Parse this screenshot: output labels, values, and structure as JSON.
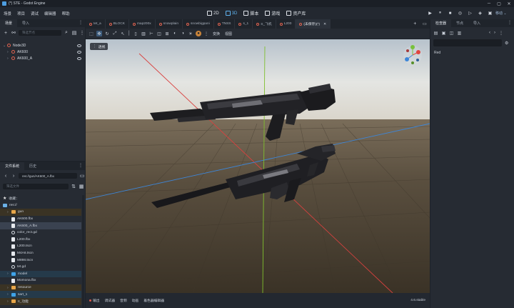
{
  "window": {
    "title": "(*) STE - Godot Engine",
    "minimize": "─",
    "maximize": "▢",
    "close": "✕"
  },
  "menu": [
    "场景",
    "项目",
    "调试",
    "编辑器",
    "帮助"
  ],
  "modes": [
    {
      "label": "2D",
      "active": false
    },
    {
      "label": "3D",
      "active": true
    },
    {
      "label": "脚本",
      "active": false
    },
    {
      "label": "游戏",
      "active": false
    },
    {
      "label": "资产库",
      "active": false
    }
  ],
  "renderer": "移动 ⌄",
  "scene_dock": {
    "tabs": [
      "场景",
      "导入"
    ],
    "filter_placeholder": "筛选节点",
    "tree": [
      {
        "label": "Node3D",
        "indent": 0
      },
      {
        "label": "AK600",
        "indent": 1
      },
      {
        "label": "AK600_A",
        "indent": 1
      }
    ]
  },
  "filesystem_dock": {
    "tabs": [
      "文件系统",
      "历史"
    ],
    "path": "res://gun/AK600_A.fbx",
    "filter_placeholder": "筛选文件",
    "items": [
      {
        "label": "收藏：",
        "icon": "star",
        "indent": 0
      },
      {
        "label": "res://",
        "icon": "folder",
        "indent": 0
      },
      {
        "label": "gun",
        "icon": "folder-orange",
        "indent": 1
      },
      {
        "label": "AK600.fbx",
        "icon": "file",
        "indent": 2
      },
      {
        "label": "AK600_A.fbx",
        "icon": "file",
        "indent": 2,
        "selected": true
      },
      {
        "label": "color_rect.gd",
        "icon": "gear",
        "indent": 2
      },
      {
        "label": "L200.fbx",
        "icon": "file",
        "indent": 2
      },
      {
        "label": "L200.tscn",
        "icon": "file",
        "indent": 2
      },
      {
        "label": "M4A6.tscn",
        "icon": "file",
        "indent": 2
      },
      {
        "label": "M898.tscn",
        "icon": "file",
        "indent": 2
      },
      {
        "label": "tet.gd",
        "icon": "gear",
        "indent": 2
      },
      {
        "label": "model",
        "icon": "folder-blue",
        "indent": 1
      },
      {
        "label": "Momona.fbx",
        "icon": "file",
        "indent": 2
      },
      {
        "label": "resource",
        "icon": "folder-orange",
        "indent": 1
      },
      {
        "label": "sart_1",
        "icon": "folder-blue",
        "indent": 1
      },
      {
        "label": "II_功能",
        "icon": "folder-orange",
        "indent": 1
      }
    ]
  },
  "editor_tabs": [
    {
      "label": "tet_a",
      "active": false
    },
    {
      "label": "BLOCK",
      "active": false
    },
    {
      "label": "map200x",
      "active": false
    },
    {
      "label": "snowplain",
      "active": false
    },
    {
      "label": "snowbigpani",
      "active": false
    },
    {
      "label": "TNSS",
      "active": false
    },
    {
      "label": "s_1",
      "active": false
    },
    {
      "label": "S_飞机",
      "active": false
    },
    {
      "label": "L200",
      "active": false
    },
    {
      "label": "(未保存)(*)",
      "active": true
    }
  ],
  "viewport_toolbar_labels": [
    "变换",
    "视图"
  ],
  "viewport_menu_label": "透视",
  "bottom_panel": [
    "输出",
    "调试器",
    "音频",
    "动画",
    "着色器编辑器"
  ],
  "version": "4.6.stable",
  "inspector": {
    "tabs": [
      "检查器",
      "节点",
      "导入"
    ],
    "property_text": "Red"
  },
  "colors": {
    "accent": "#5fb3f0",
    "error_dot": "#e05a4a",
    "node_icon": "#e0634f",
    "folder_orange": "#e7a64a",
    "folder_blue": "#3fa3e8"
  }
}
